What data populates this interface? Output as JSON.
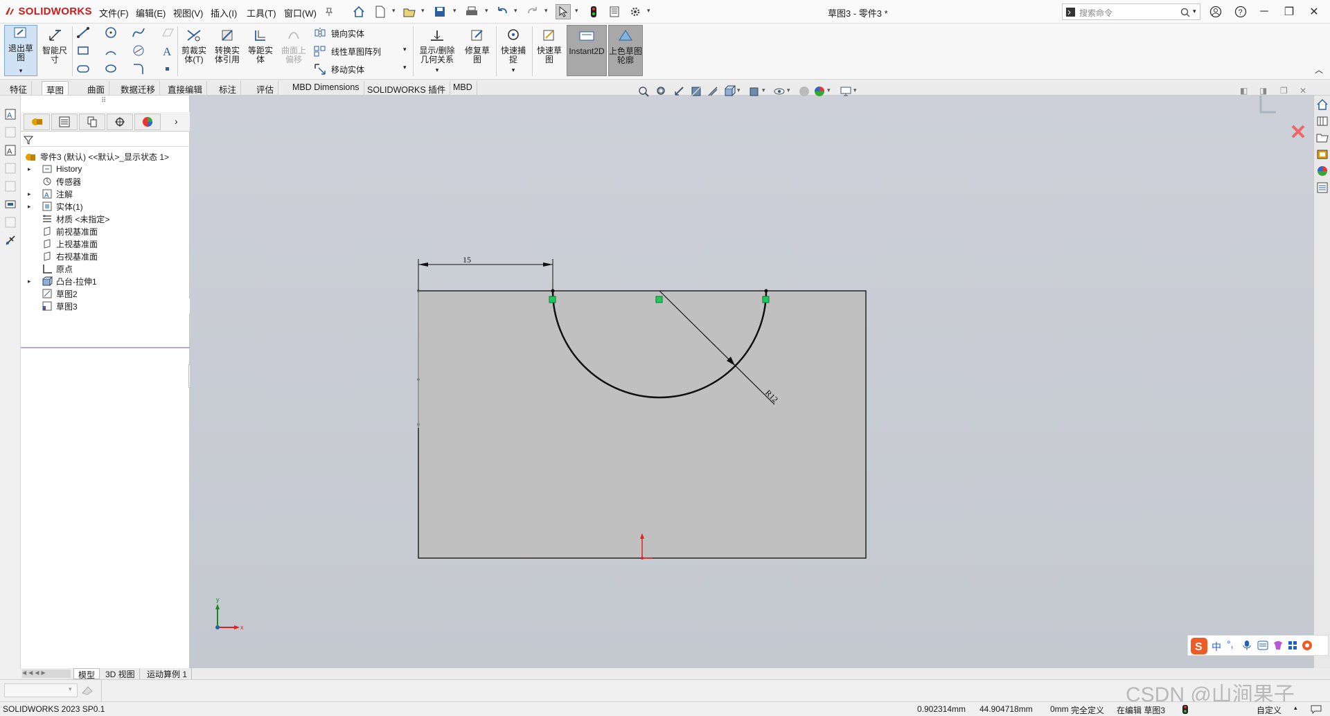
{
  "app": {
    "brand": "SOLIDWORKS",
    "doc_title": "草图3 - 零件3 *"
  },
  "menus": [
    "文件(F)",
    "编辑(E)",
    "视图(V)",
    "插入(I)",
    "工具(T)",
    "窗口(W)"
  ],
  "search": {
    "placeholder": "搜索命令"
  },
  "ribbon": {
    "exit_sketch": "退出草图",
    "smart_dim": "智能尺寸",
    "trim": "剪裁实体(T)",
    "convert": "转换实体引用",
    "offset": "等距实体",
    "surface_offset": "曲面上偏移",
    "mirror": "镜向实体",
    "linear_pattern": "线性草图阵列",
    "move": "移动实体",
    "show_delete": "显示/删除几何关系",
    "repair": "修复草图",
    "quick_snap": "快速捕捉",
    "rapid_sketch": "快速草图",
    "instant2d": "Instant2D",
    "shaded_contour": "上色草图轮廓"
  },
  "tabs": [
    "特征",
    "草图",
    "曲面",
    "数据迁移",
    "直接编辑",
    "标注",
    "评估",
    "MBD Dimensions",
    "SOLIDWORKS 插件",
    "MBD"
  ],
  "tree": {
    "root": "零件3 (默认) <<默认>_显示状态 1>",
    "items": [
      {
        "label": "History",
        "expandable": true
      },
      {
        "label": "传感器",
        "expandable": false
      },
      {
        "label": "注解",
        "expandable": true
      },
      {
        "label": "实体(1)",
        "expandable": true
      },
      {
        "label": "材质 <未指定>",
        "expandable": false
      },
      {
        "label": "前视基准面",
        "expandable": false
      },
      {
        "label": "上视基准面",
        "expandable": false
      },
      {
        "label": "右视基准面",
        "expandable": false
      },
      {
        "label": "原点",
        "expandable": false
      },
      {
        "label": "凸台-拉伸1",
        "expandable": true
      },
      {
        "label": "草图2",
        "expandable": false
      },
      {
        "label": "草图3",
        "expandable": false
      }
    ]
  },
  "sketch": {
    "dim_horizontal": "15",
    "dim_radius": "R12",
    "axis_x": "x",
    "axis_y": "y"
  },
  "bottom_tabs": [
    "模型",
    "3D 视图",
    "运动算例 1"
  ],
  "status": {
    "version": "SOLIDWORKS 2023 SP0.1",
    "x": "0.902314mm",
    "y": "44.904718mm",
    "z": "0mm",
    "definition": "完全定义",
    "editing": "在编辑 草图3",
    "units": "自定义"
  },
  "watermark": "CSDN @山涧果子",
  "colors": {
    "brand": "#d01a1a",
    "accent": "#0078d7",
    "constraint": "#22c55e"
  }
}
